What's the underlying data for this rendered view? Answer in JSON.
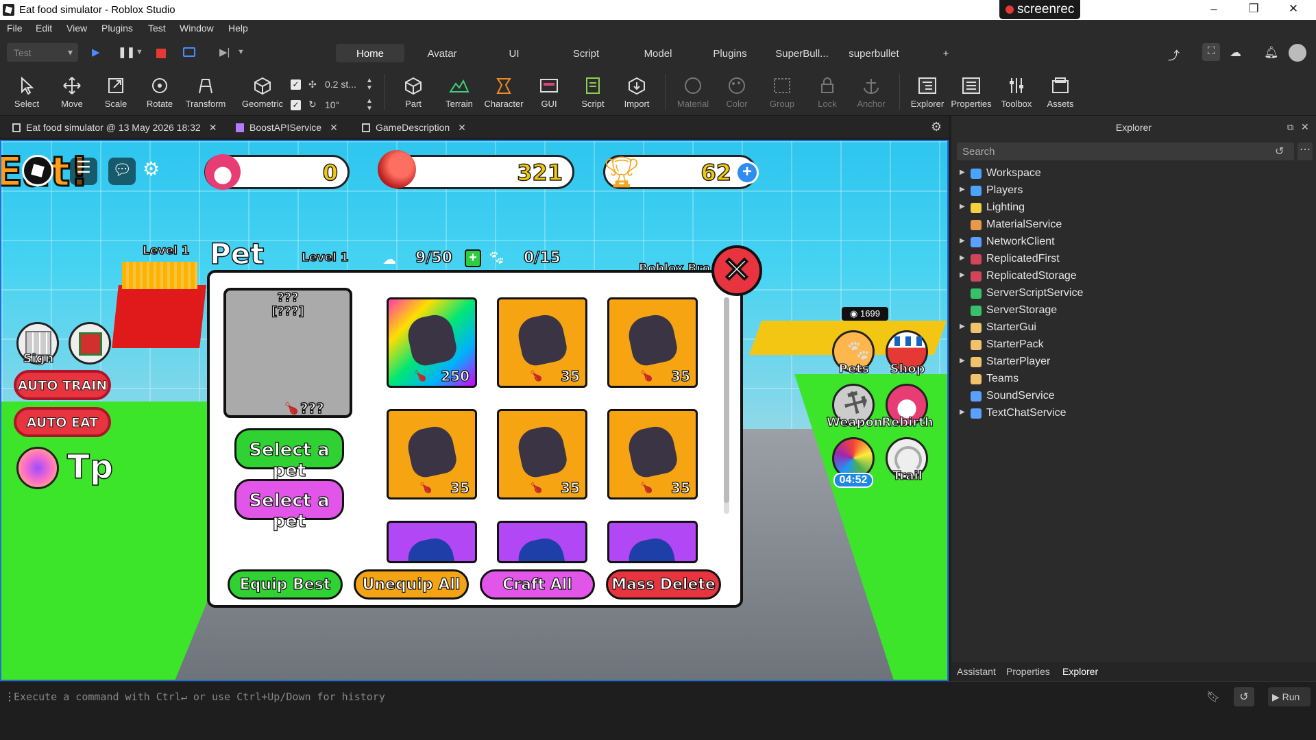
{
  "window": {
    "title": "Eat food simulator - Roblox Studio",
    "recorder": "screenrec"
  },
  "menu": [
    "File",
    "Edit",
    "View",
    "Plugins",
    "Test",
    "Window",
    "Help"
  ],
  "toolbar": {
    "mode_select": "Test",
    "ribbon_tabs": [
      "Home",
      "Avatar",
      "UI",
      "Script",
      "Model",
      "Plugins",
      "SuperBull...",
      "superbullet",
      "+"
    ],
    "active_tab": "Home",
    "tools_left": [
      "Select",
      "Move",
      "Scale",
      "Rotate",
      "Transform"
    ],
    "geometric": "Geometric",
    "move_increment": "0.2 st...",
    "rotate_increment": "10°",
    "tools_mid": [
      "Part",
      "Terrain",
      "Character",
      "GUI",
      "Script",
      "Import"
    ],
    "tools_dim": [
      "Material",
      "Color",
      "Group",
      "Lock",
      "Anchor"
    ],
    "tools_right": [
      "Explorer",
      "Properties",
      "Toolbox",
      "Assets"
    ]
  },
  "doc_tabs": [
    "Eat food simulator @ 13 May 2026 18:32",
    "BoostAPIService",
    "GameDescription"
  ],
  "game": {
    "stats": {
      "eggs": "0",
      "food": "321",
      "trophies": "62"
    },
    "left_level": "Level 1",
    "left_buttons": {
      "sign": "Sign",
      "auto_train": "AUTO TRAIN",
      "auto_eat": "AUTO EAT",
      "tp": "Tp"
    },
    "right_buttons": {
      "pets": "Pets",
      "shop": "Shop",
      "weapon": "Weapon",
      "rebirth": "Rebirth",
      "timer": "04:52",
      "trail": "Trail"
    },
    "world_label": "1699",
    "panel": {
      "title": "Pet",
      "level": "Level 1",
      "pet_count": "9/50",
      "equip_count": "0/15",
      "behind_label": "Roblox Bro",
      "preview_name": "???",
      "preview_rarity": "[???]",
      "preview_boost": "???",
      "select_btn_1": "Select a pet",
      "select_btn_2": "Select a pet",
      "pets": [
        {
          "style": "rainbow",
          "boost": "250"
        },
        {
          "style": "orange",
          "boost": "35"
        },
        {
          "style": "orange",
          "boost": "35"
        },
        {
          "style": "orange",
          "boost": "35"
        },
        {
          "style": "orange",
          "boost": "35"
        },
        {
          "style": "orange",
          "boost": "35"
        },
        {
          "style": "purple",
          "boost": ""
        },
        {
          "style": "purple",
          "boost": ""
        },
        {
          "style": "purple",
          "boost": ""
        }
      ],
      "actions": {
        "equip_best": "Equip Best",
        "unequip_all": "Unequip All",
        "craft_all": "Craft All",
        "mass_delete": "Mass Delete"
      }
    }
  },
  "command_bar": {
    "placeholder": "Execute a command with Ctrl↵ or use Ctrl+Up/Down for history",
    "run": "Run"
  },
  "explorer": {
    "title": "Explorer",
    "search_placeholder": "Search",
    "items": [
      {
        "label": "Workspace",
        "color": "#4aa3ff",
        "expand": true
      },
      {
        "label": "Players",
        "color": "#4aa3ff",
        "expand": true
      },
      {
        "label": "Lighting",
        "color": "#f5d142",
        "expand": true
      },
      {
        "label": "MaterialService",
        "color": "#e59a4a",
        "expand": false
      },
      {
        "label": "NetworkClient",
        "color": "#5aa0ff",
        "expand": true
      },
      {
        "label": "ReplicatedFirst",
        "color": "#d0455a",
        "expand": true
      },
      {
        "label": "ReplicatedStorage",
        "color": "#d0455a",
        "expand": true
      },
      {
        "label": "ServerScriptService",
        "color": "#36c26b",
        "expand": false
      },
      {
        "label": "ServerStorage",
        "color": "#36c26b",
        "expand": false
      },
      {
        "label": "StarterGui",
        "color": "#f0c36b",
        "expand": true
      },
      {
        "label": "StarterPack",
        "color": "#f0c36b",
        "expand": false
      },
      {
        "label": "StarterPlayer",
        "color": "#f0c36b",
        "expand": true
      },
      {
        "label": "Teams",
        "color": "#f0c36b",
        "expand": false
      },
      {
        "label": "SoundService",
        "color": "#5aa0ff",
        "expand": false
      },
      {
        "label": "TextChatService",
        "color": "#5aa0ff",
        "expand": true
      }
    ],
    "bottom_tabs": [
      "Assistant",
      "Properties",
      "Explorer"
    ]
  }
}
